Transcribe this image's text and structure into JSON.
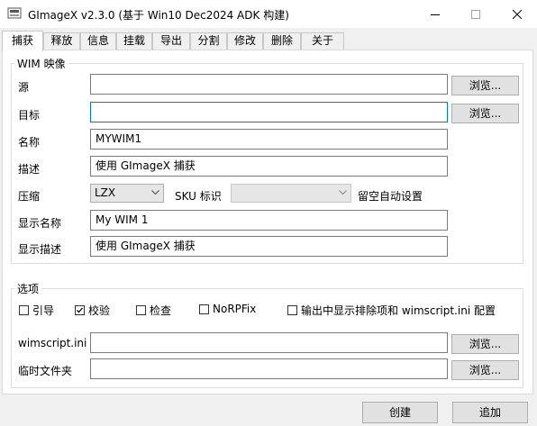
{
  "window": {
    "title": "GImageX v2.3.0 (基于 Win10 Dec2024 ADK 构建)"
  },
  "tabs": [
    {
      "label": "捕获",
      "active": true
    },
    {
      "label": "释放"
    },
    {
      "label": "信息"
    },
    {
      "label": "挂载"
    },
    {
      "label": "导出"
    },
    {
      "label": "分割"
    },
    {
      "label": "修改"
    },
    {
      "label": "删除"
    },
    {
      "label": "关于"
    }
  ],
  "wim_group": {
    "title": "WIM 映像",
    "source_label": "源",
    "source_value": "",
    "target_label": "目标",
    "target_value": "",
    "name_label": "名称",
    "name_value": "MYWIM1",
    "desc_label": "描述",
    "desc_value": "使用 GImageX 捕获",
    "compress_label": "压缩",
    "compress_value": "LZX",
    "sku_label": "SKU 标识",
    "sku_value": "",
    "oobe_label": "留空自动设置",
    "display_name_label": "显示名称",
    "display_name_value": "My WIM 1",
    "display_desc_label": "显示描述",
    "display_desc_value": "使用 GImageX 捕获"
  },
  "browse_label": "浏览...",
  "options_group": {
    "title": "选项",
    "checks": [
      {
        "label": "引导",
        "checked": false
      },
      {
        "label": "校验",
        "checked": true
      },
      {
        "label": "检查",
        "checked": false
      },
      {
        "label": "NoRPFix",
        "checked": false
      },
      {
        "label": "输出中显示排除项和 wimscript.ini 配置",
        "checked": false
      }
    ],
    "wimscript_label": "wimscript.ini",
    "wimscript_value": "",
    "temp_label": "临时文件夹",
    "temp_value": ""
  },
  "actions": {
    "create_label": "创建",
    "append_label": "追加"
  },
  "colors": {
    "accent": "#0078d7",
    "tab_active_bg": "#ffffff",
    "window_bg": "#f0f0f0"
  }
}
